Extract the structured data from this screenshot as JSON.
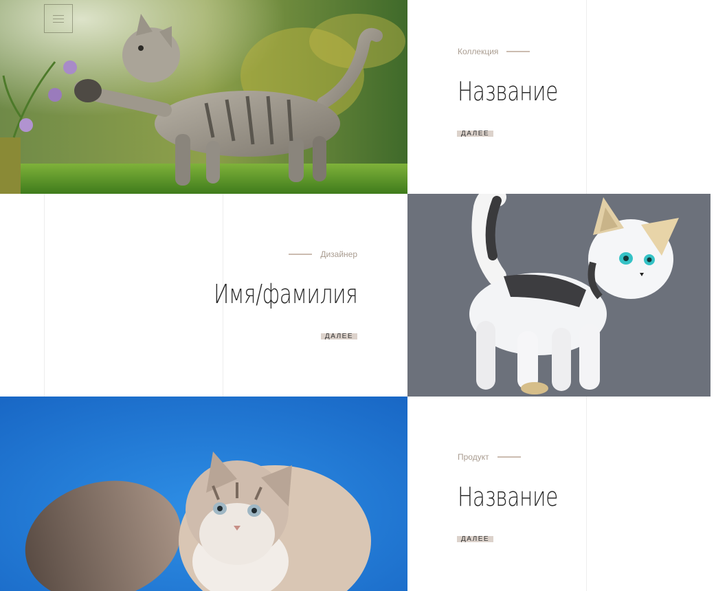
{
  "menu": {
    "icon": "hamburger-icon"
  },
  "items": [
    {
      "image": "tabby-kitten-photo",
      "label": "Коллекция",
      "title": "Название",
      "more": "ДАЛЕЕ"
    },
    {
      "image": "white-cat-illustration",
      "label": "Дизайнер",
      "title": "Имя/фамилия",
      "more": "ДАЛЕЕ"
    },
    {
      "image": "fluffy-cat-photo",
      "label": "Продукт",
      "title": "Название",
      "more": "ДАЛЕЕ"
    }
  ],
  "colors": {
    "label": "#a99c90",
    "dash": "#cbbcb0",
    "more_bg": "#dcd2cb",
    "gray_panel": "#6c717b",
    "blue_panel": "#1e7fd6"
  }
}
